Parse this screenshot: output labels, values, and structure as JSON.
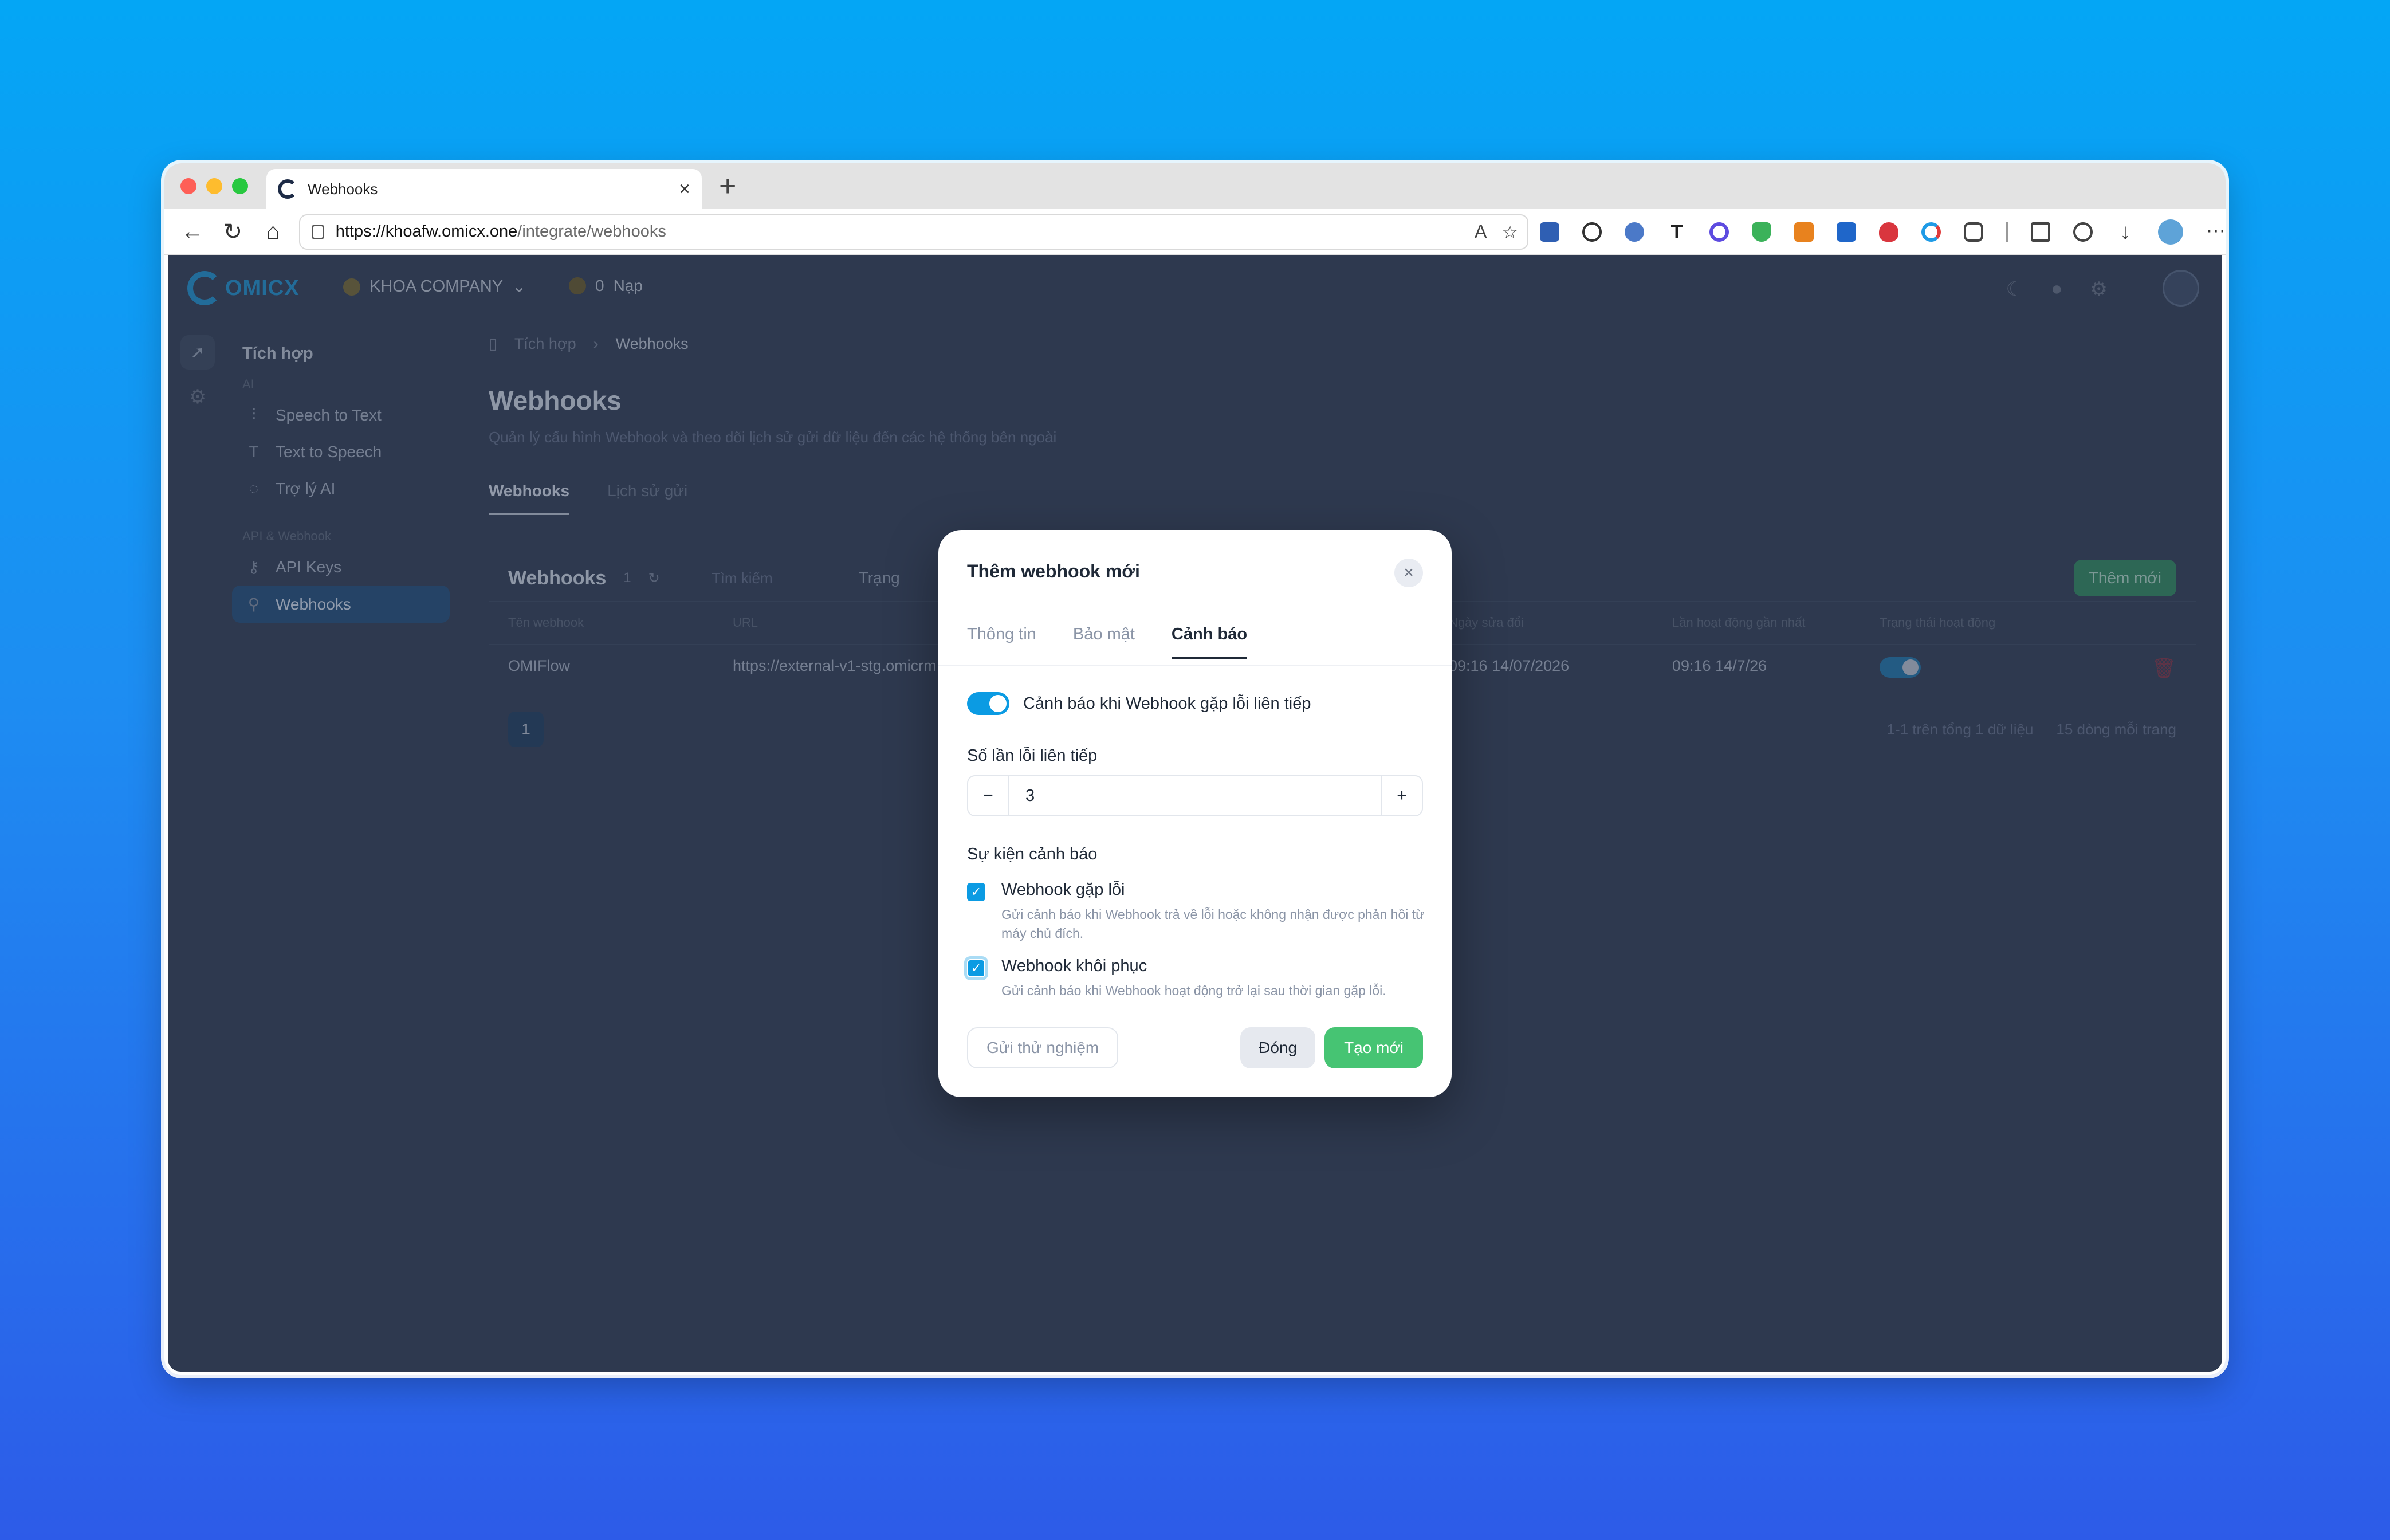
{
  "browser": {
    "tab_title": "Webhooks",
    "url_host": "https://khoafw.omicx.one",
    "url_path": "/integrate/webhooks"
  },
  "header": {
    "logo_text": "OMICX",
    "company": "KHOA COMPANY",
    "credit_value": "0",
    "credit_label": "Nạp"
  },
  "sidebar": {
    "title": "Tích hợp",
    "section_ai": "AI",
    "section_api": "API & Webhook",
    "items": [
      {
        "label": "Speech to Text"
      },
      {
        "label": "Text to Speech"
      },
      {
        "label": "Trợ lý AI"
      },
      {
        "label": "API Keys"
      },
      {
        "label": "Webhooks"
      }
    ]
  },
  "main": {
    "breadcrumb": [
      "Tích hợp",
      "Webhooks"
    ],
    "title": "Webhooks",
    "subtitle": "Quản lý cấu hình Webhook và theo dõi lịch sử gửi dữ liệu đến các hệ thống bên ngoài",
    "tabs": [
      "Webhooks",
      "Lịch sử gửi"
    ],
    "card": {
      "title": "Webhooks",
      "count": "1",
      "search_placeholder": "Tìm kiếm",
      "status_label": "Trạng",
      "add_button": "Thêm mới",
      "columns": [
        "Tên webhook",
        "URL",
        "Ngày sửa đổi",
        "Lần hoạt động gần nhất",
        "Trạng thái hoạt động"
      ],
      "rows": [
        {
          "name": "OMIFlow",
          "url": "https://external-v1-stg.omicrm.com/api/camp",
          "modified": "09:16 14/07/2026",
          "last_active": "09:16 14/7/26"
        }
      ],
      "page": "1",
      "summary": "1-1 trên tổng 1 dữ liệu",
      "per_page": "15 dòng mỗi trang"
    }
  },
  "modal": {
    "title": "Thêm webhook mới",
    "tabs": [
      "Thông tin",
      "Bảo mật",
      "Cảnh báo"
    ],
    "toggle_label": "Cảnh báo khi Webhook gặp lỗi liên tiếp",
    "field_label": "Số lần lỗi liên tiếp",
    "stepper_value": "3",
    "events_label": "Sự kiện cảnh báo",
    "events": [
      {
        "title": "Webhook gặp lỗi",
        "desc": "Gửi cảnh báo khi Webhook trả về lỗi hoặc không nhận được phản hồi từ máy chủ đích."
      },
      {
        "title": "Webhook khôi phục",
        "desc": "Gửi cảnh báo khi Webhook hoạt động trở lại sau thời gian gặp lỗi."
      }
    ],
    "btn_test": "Gửi thử nghiệm",
    "btn_close": "Đóng",
    "btn_create": "Tạo mới"
  },
  "colors": {
    "accent_blue": "#0b9be3",
    "create_green": "#46c473",
    "app_overlay": "#2e394f"
  }
}
